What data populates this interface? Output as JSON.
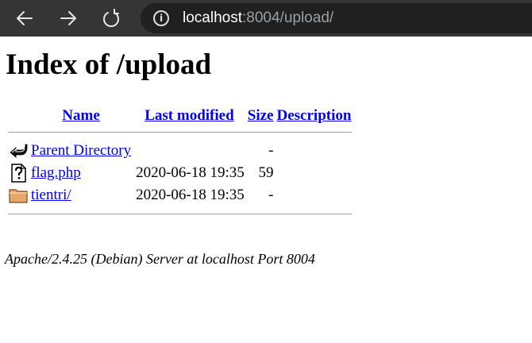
{
  "browser": {
    "url_host": "localhost",
    "url_rest": ":8004/upload/",
    "info_label": "i"
  },
  "page": {
    "title": "Index of /upload",
    "columns": {
      "name": "Name",
      "last_modified": "Last modified",
      "size": "Size",
      "description": "Description"
    },
    "rows": [
      {
        "icon": "back-icon",
        "name": "Parent Directory",
        "modified": "",
        "size": "-",
        "description": ""
      },
      {
        "icon": "unknown-file-icon",
        "name": "flag.php",
        "modified": "2020-06-18 19:35",
        "size": "59",
        "description": ""
      },
      {
        "icon": "folder-icon",
        "name": "tientri/",
        "modified": "2020-06-18 19:35",
        "size": "-",
        "description": ""
      }
    ],
    "footer": "Apache/2.4.25 (Debian) Server at localhost Port 8004"
  },
  "colors": {
    "chrome_bg": "#353535",
    "address_bg": "#202020",
    "link": "#0000ee"
  }
}
